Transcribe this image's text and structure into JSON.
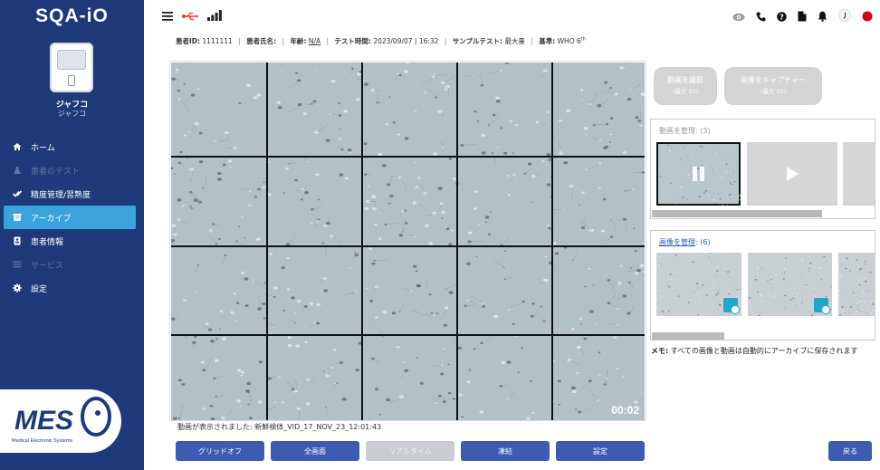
{
  "app": {
    "logo_text": "SQA-iO"
  },
  "device": {
    "name": "ジャフコ",
    "subname": "ジャフコ"
  },
  "sidebar": {
    "items": [
      {
        "label": "ホーム",
        "icon": "home-icon",
        "state": "normal"
      },
      {
        "label": "患者のテスト",
        "icon": "flask-icon",
        "state": "disabled"
      },
      {
        "label": "精度管理/習熟度",
        "icon": "double-check-icon",
        "state": "normal"
      },
      {
        "label": "アーカイブ",
        "icon": "archive-icon",
        "state": "active"
      },
      {
        "label": "患者情報",
        "icon": "patient-card-icon",
        "state": "normal"
      },
      {
        "label": "サービス",
        "icon": "list-icon",
        "state": "disabled"
      },
      {
        "label": "設定",
        "icon": "gear-icon",
        "state": "normal"
      }
    ],
    "company_logo_text": "MES",
    "company_logo_subtext": "Medical Electronic Systems"
  },
  "topbar": {
    "left_icons": [
      "menu-icon",
      "usb-icon",
      "signal-icon"
    ],
    "right_icons": [
      "eye-icon",
      "phone-icon",
      "help-icon",
      "document-icon",
      "bell-icon",
      "user-icon",
      "status-dot-icon"
    ]
  },
  "info": {
    "patient_id_label": "患者ID:",
    "patient_id": "1111111",
    "patient_name_label": "患者氏名:",
    "patient_name": "",
    "age_label": "年齢:",
    "age": "N/A",
    "test_time_label": "テスト時間:",
    "test_time": "2023/09/07 | 16:32",
    "sample_test_label": "サンプルテスト:",
    "sample_test": "最大量",
    "standard_label": "基準:",
    "standard": "WHO 6",
    "standard_sup": "th"
  },
  "video": {
    "timecode": "00:02",
    "caption": "動画が表示されました: 新鮮検体_VID_17_NOV_23_12:01:43"
  },
  "controls": {
    "grid_off": "グリッドオフ",
    "fullscreen": "全画面",
    "realtime": "リアルタイム",
    "freeze": "凍結",
    "settings": "設定"
  },
  "capture": {
    "record_video": "動画を撮影",
    "record_video_sub": "(最大 10)",
    "capture_image": "画像をキャプチャー",
    "capture_image_sub": "(最大 10)"
  },
  "videos_panel": {
    "title": "動画を管理: (3)"
  },
  "images_panel": {
    "title_link": "画像を管理",
    "title_count": ": (6)"
  },
  "memo": {
    "label": "メモ:",
    "text": " すべての画像と動画は自動的にアーカイブに保存されます"
  },
  "back_button": "戻る",
  "colors": {
    "sidebar_bg": "#1e3a7a",
    "active_nav": "#3aa3dc",
    "primary_button": "#3d5bb0",
    "status_dot": "#d0021b",
    "usb": "#e53935"
  }
}
